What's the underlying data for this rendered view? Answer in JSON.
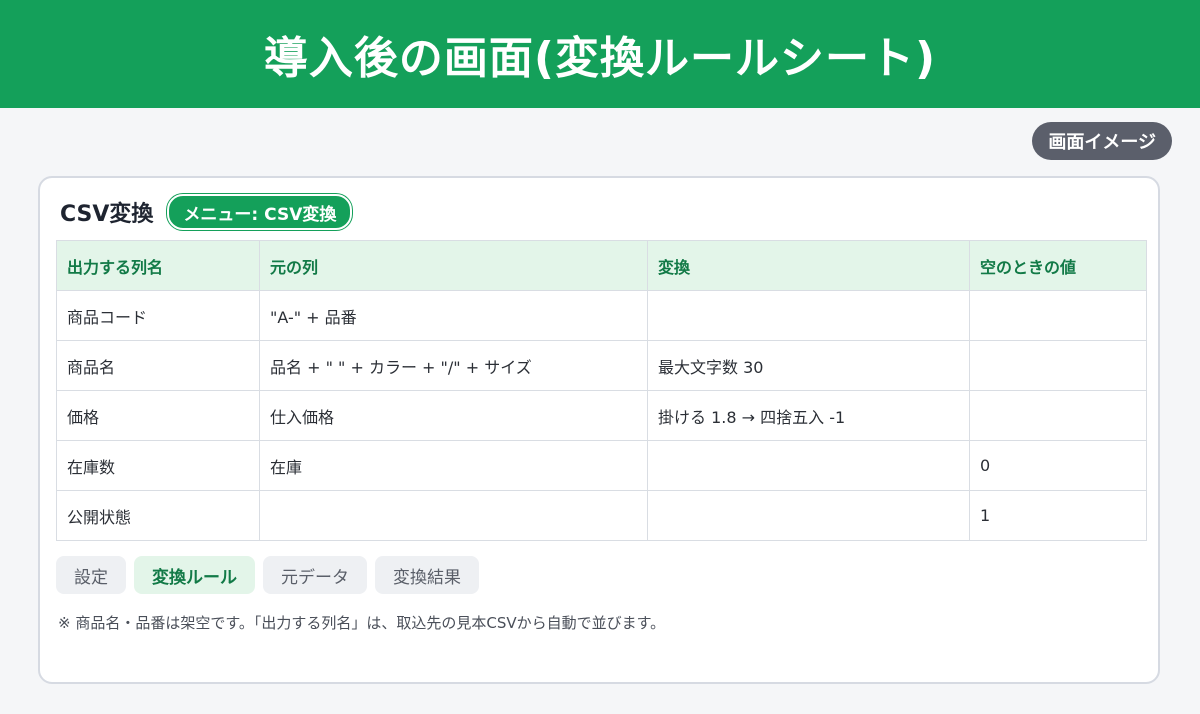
{
  "header": {
    "title": "導入後の画面(変換ルールシート)"
  },
  "image_badge": "画面イメージ",
  "card": {
    "title": "CSV変換",
    "menu_pill": "メニュー: CSV変換"
  },
  "table": {
    "columns": [
      "出力する列名",
      "元の列",
      "変換",
      "空のときの値"
    ],
    "rows": [
      [
        "商品コード",
        "\"A-\" + 品番",
        "",
        ""
      ],
      [
        "商品名",
        "品名 + \" \" + カラー + \"/\" + サイズ",
        "最大文字数 30",
        ""
      ],
      [
        "価格",
        "仕入価格",
        "掛ける 1.8 → 四捨五入 -1",
        ""
      ],
      [
        "在庫数",
        "在庫",
        "",
        "0"
      ],
      [
        "公開状態",
        "",
        "",
        "1"
      ]
    ]
  },
  "tabs": [
    {
      "label": "設定",
      "active": false
    },
    {
      "label": "変換ルール",
      "active": true
    },
    {
      "label": "元データ",
      "active": false
    },
    {
      "label": "変換結果",
      "active": false
    }
  ],
  "note": "※ 商品名・品番は架空です。「出力する列名」は、取込先の見本CSVから自動で並びます。",
  "colors": {
    "brand_green": "#14a05a",
    "header_row_bg": "#e3f5e9",
    "badge_gray": "#5b5f6b"
  }
}
